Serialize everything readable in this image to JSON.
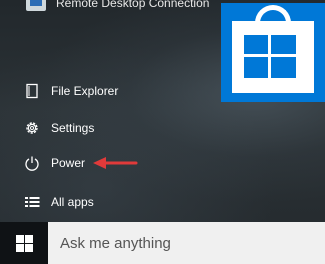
{
  "start_menu": {
    "recent_app": {
      "label": "Remote Desktop Connection",
      "icon": "remote-desktop-icon"
    },
    "tiles": [
      {
        "name": "Store",
        "icon": "store-bag-icon",
        "color": "#0078d7"
      }
    ],
    "items": [
      {
        "label": "File Explorer",
        "icon": "file-explorer-icon"
      },
      {
        "label": "Settings",
        "icon": "gear-icon"
      },
      {
        "label": "Power",
        "icon": "power-icon"
      },
      {
        "label": "All apps",
        "icon": "all-apps-icon"
      }
    ],
    "annotation_arrow_color": "#e03a3a"
  },
  "taskbar": {
    "start_icon": "windows-logo-icon",
    "search": {
      "placeholder": "Ask me anything",
      "value": ""
    }
  }
}
